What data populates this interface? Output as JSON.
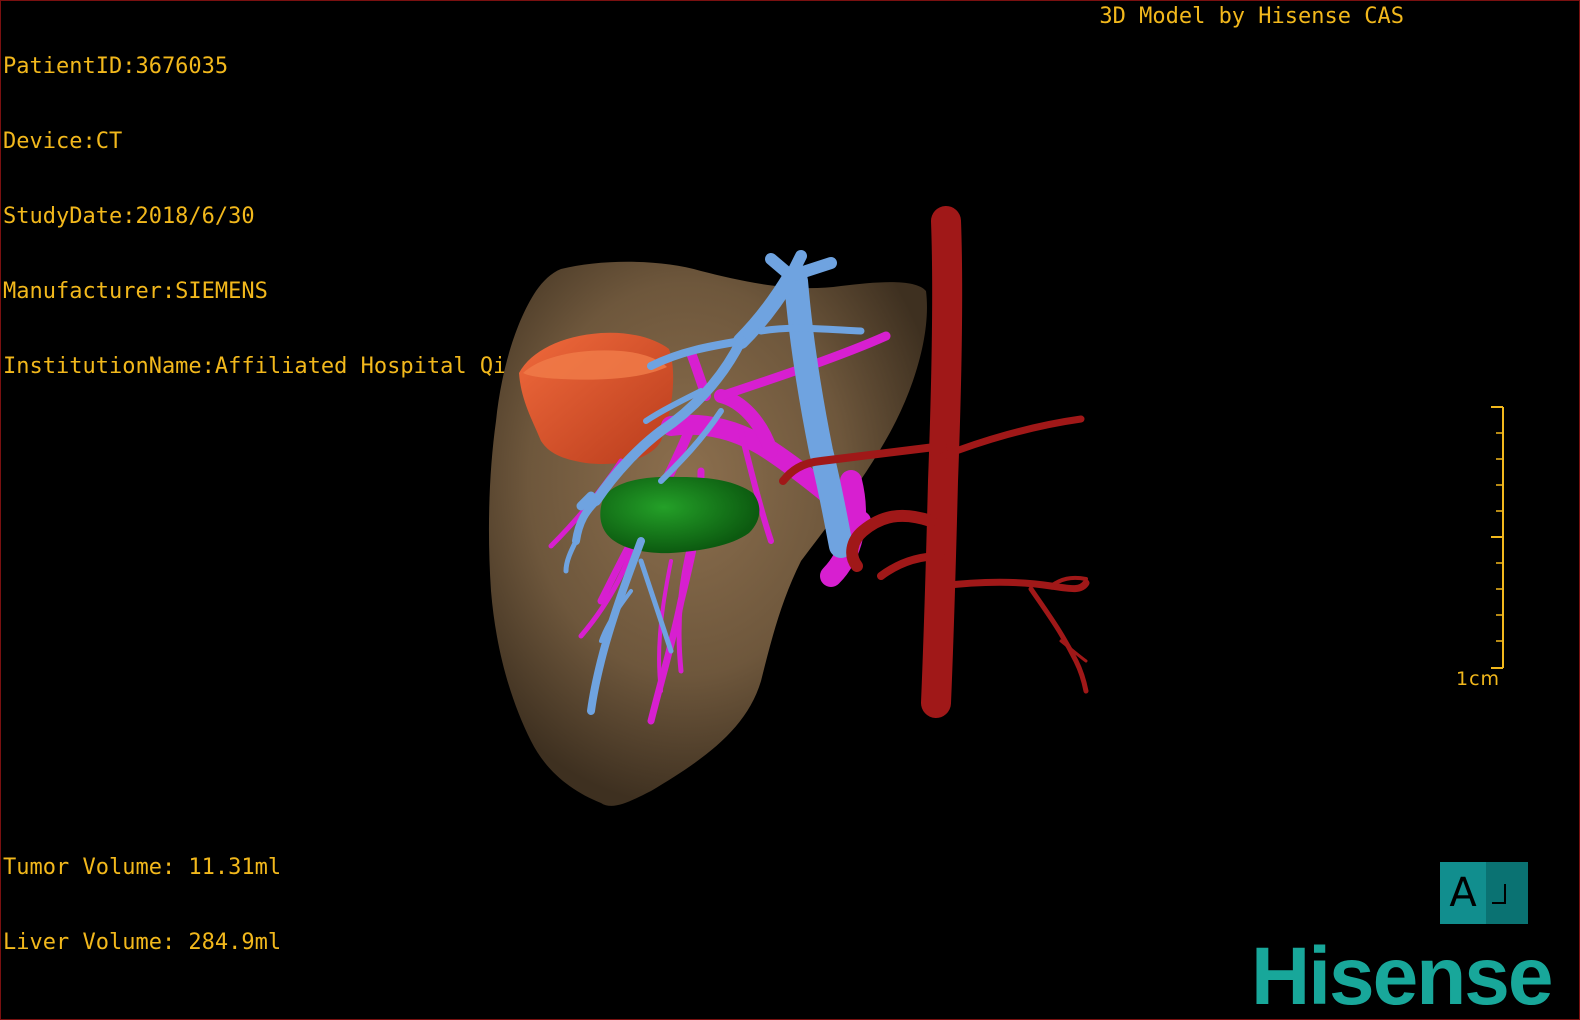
{
  "study_info": {
    "patient_id": "PatientID:3676035",
    "device": "Device:CT",
    "study_date": "StudyDate:2018/6/30",
    "manufacturer": "Manufacturer:SIEMENS",
    "institution": "InstitutionName:Affiliated Hospital Qingdao University-C"
  },
  "model_credit": "3D Model by Hisense CAS",
  "volumes": {
    "tumor": "Tumor Volume: 11.31ml",
    "liver": "Liver Volume: 284.9ml"
  },
  "scale_bar": {
    "label": "1cm"
  },
  "orientation_widget": {
    "label": "A",
    "icon": "orientation-marker-icon"
  },
  "brand": "Hisense",
  "colors": {
    "overlay_text": "#f2b81c",
    "liver": "#7a6144",
    "tumor": "#d9522c",
    "portal_vein": "#6fa3e0",
    "hepatic_vein": "#d71fd0",
    "gallbladder": "#157a18",
    "artery": "#a01818",
    "brand": "#18a79a"
  }
}
